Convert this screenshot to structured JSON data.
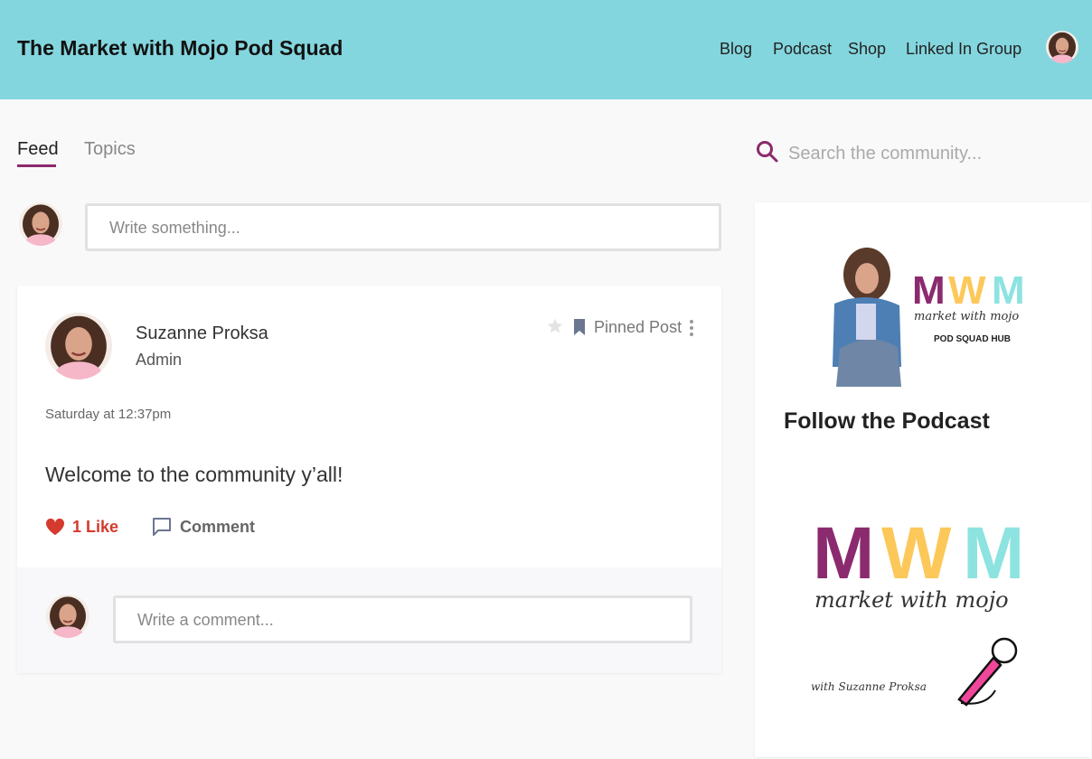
{
  "header": {
    "title": "The Market with Mojo Pod Squad",
    "nav": [
      "Blog",
      "Podcast",
      "Shop",
      "Linked In Group"
    ]
  },
  "tabs": [
    "Feed",
    "Topics"
  ],
  "search": {
    "placeholder": "Search the community..."
  },
  "composer": {
    "placeholder": "Write something..."
  },
  "post": {
    "author": "Suzanne Proksa",
    "role": "Admin",
    "pinned_label": "Pinned Post",
    "time": "Saturday at 12:37pm",
    "body": "Welcome to the community y’all!",
    "like_label": "1 Like",
    "comment_label": "Comment",
    "comment_placeholder": "Write a comment..."
  },
  "sidebar": {
    "hub_logo": {
      "letters": [
        "M",
        "W",
        "M"
      ],
      "script": "market with mojo",
      "subtitle": "POD SQUAD HUB"
    },
    "heading": "Follow the Podcast",
    "podcast_logo": {
      "letters": [
        "M",
        "W",
        "M"
      ],
      "script": "market with mojo",
      "byline": "with Suzanne Proksa"
    }
  },
  "colors": {
    "header_bg": "#84d6de",
    "accent": "#8b2a6e",
    "like": "#d43a2e",
    "logo_purple": "#8b2a6e",
    "logo_yellow": "#fcc85a",
    "logo_teal": "#8de3e0",
    "mic_pink": "#f0479a"
  },
  "icons": [
    "search-icon",
    "star-icon",
    "bookmark-icon",
    "more-vertical-icon",
    "heart-icon",
    "comment-icon",
    "microphone-icon"
  ]
}
